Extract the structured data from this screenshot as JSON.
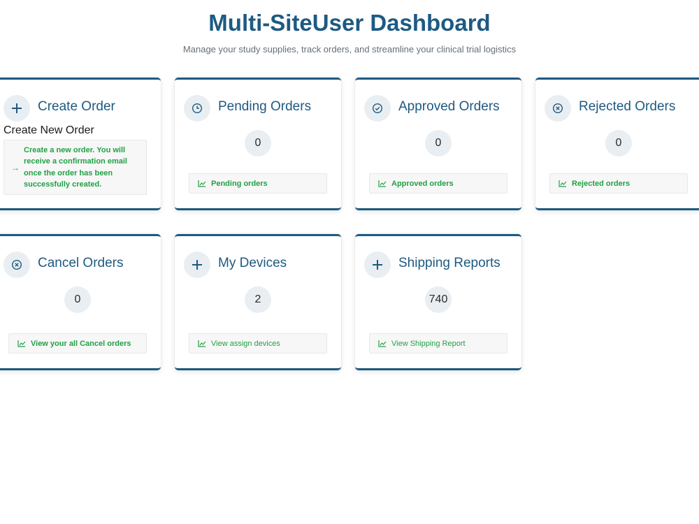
{
  "page": {
    "title": "Multi-SiteUser Dashboard",
    "subtitle": "Manage your study supplies, track orders, and streamline your clinical trial logistics"
  },
  "colors": {
    "primary": "#1d5a82",
    "link_green": "#22a045",
    "icon_bg": "#e9eef2",
    "panel_bg": "#f7f7f7"
  },
  "cards": {
    "create_order": {
      "title": "Create Order",
      "icon": "plus-icon",
      "heading": "Create New Order",
      "description": "Create a new order. You will receive a confirmation email once the order has been successfully created."
    },
    "pending_orders": {
      "title": "Pending Orders",
      "icon": "clock-icon",
      "count": "0",
      "link": "Pending orders"
    },
    "approved_orders": {
      "title": "Approved Orders",
      "icon": "check-circle-icon",
      "count": "0",
      "link": "Approved orders"
    },
    "rejected_orders": {
      "title": "Rejected Orders",
      "icon": "x-circle-icon",
      "count": "0",
      "link": "Rejected orders"
    },
    "cancel_orders": {
      "title": "Cancel Orders",
      "icon": "x-circle-icon",
      "count": "0",
      "link": "View your all Cancel orders"
    },
    "my_devices": {
      "title": "My Devices",
      "icon": "plus-icon",
      "count": "2",
      "link": "View assign devices"
    },
    "shipping_reports": {
      "title": "Shipping Reports",
      "icon": "plus-icon",
      "count": "740",
      "link": "View Shipping Report"
    }
  }
}
